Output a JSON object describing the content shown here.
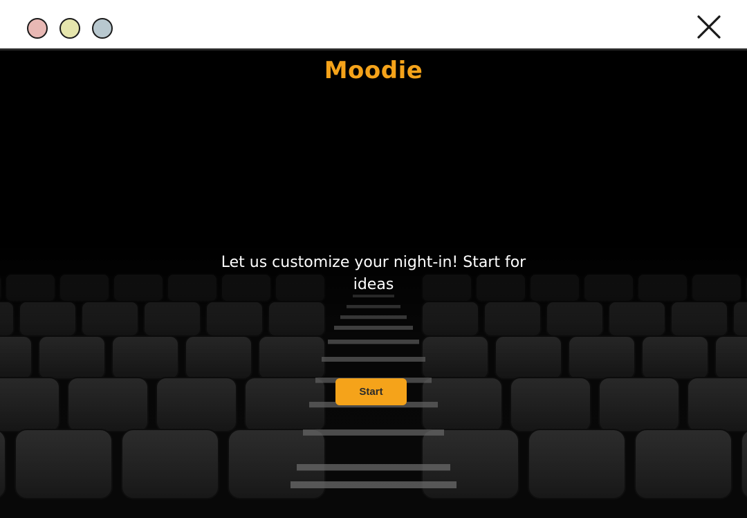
{
  "window": {
    "controls": [
      {
        "name": "close-dot",
        "color": "#e8b8b4"
      },
      {
        "name": "minimize-dot",
        "color": "#e6e6ad"
      },
      {
        "name": "maximize-dot",
        "color": "#b8c8cf"
      }
    ],
    "close_icon": "close-icon"
  },
  "app": {
    "title": "Moodie",
    "accent_color": "#f5a31a"
  },
  "hero": {
    "tagline": "Let us customize your night-in! Start for ideas",
    "start_label": "Start",
    "background": "dark movie theater seating"
  }
}
